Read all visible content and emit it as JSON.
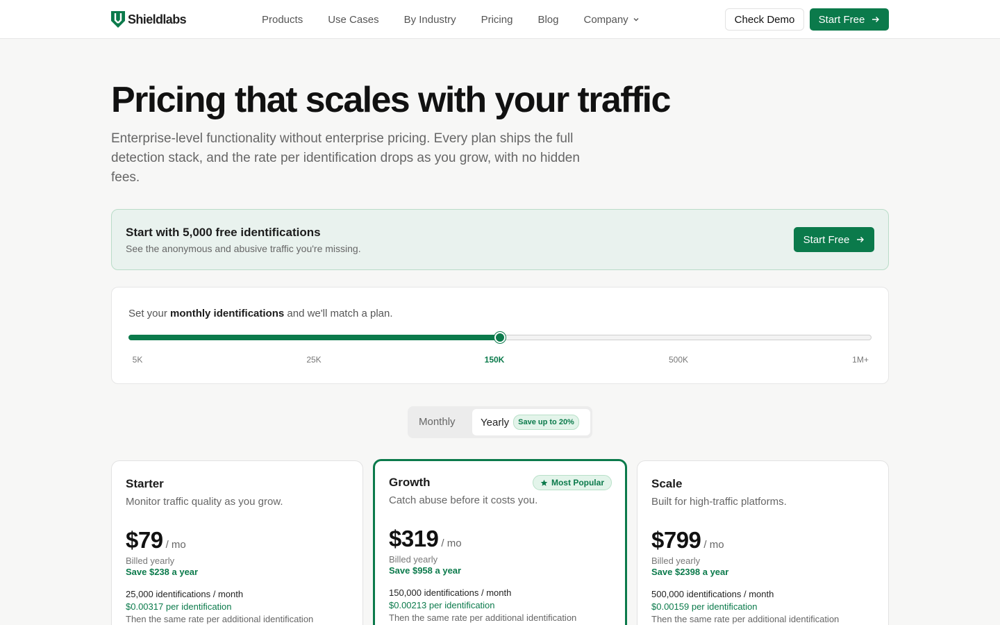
{
  "nav": {
    "brand": "Shieldlabs",
    "links": [
      "Products",
      "Use Cases",
      "By Industry",
      "Pricing",
      "Blog",
      "Company"
    ],
    "check_demo": "Check Demo",
    "start_free": "Start Free"
  },
  "hero": {
    "title": "Pricing that scales with your traffic",
    "subtitle": "Enterprise-level functionality without enterprise pricing. Every plan ships the full detection stack, and the rate per identification drops as you grow, with no hidden fees."
  },
  "banner": {
    "title": "Start with 5,000 free identifications",
    "subtitle": "See the anonymous and abusive traffic you're missing.",
    "button": "Start Free"
  },
  "slider": {
    "text_before": "Set your ",
    "text_bold": "monthly identifications",
    "text_after": " and we'll match a plan.",
    "ticks": [
      "5K",
      "25K",
      "150K",
      "500K",
      "1M+"
    ],
    "active_tick": "150K",
    "value_fraction": 0.5
  },
  "billing_toggle": {
    "monthly": "Monthly",
    "yearly": "Yearly",
    "yearly_badge": "Save up to 20%",
    "selected": "Yearly"
  },
  "plans": [
    {
      "name": "Starter",
      "description": "Monitor traffic quality as you grow.",
      "price": "$79",
      "per": "/ mo",
      "billed": "Billed yearly",
      "save": "Save $238 a year",
      "identifications": "25,000 identifications / month",
      "rate": "$0.00317 per identification",
      "then": "Then the same rate per additional identification"
    },
    {
      "name": "Growth",
      "description": "Catch abuse before it costs you.",
      "badge": "Most Popular",
      "price": "$319",
      "per": "/ mo",
      "billed": "Billed yearly",
      "save": "Save $958 a year",
      "identifications": "150,000 identifications / month",
      "rate": "$0.00213 per identification",
      "then": "Then the same rate per additional identification"
    },
    {
      "name": "Scale",
      "description": "Built for high-traffic platforms.",
      "price": "$799",
      "per": "/ mo",
      "billed": "Billed yearly",
      "save": "Save $2398 a year",
      "identifications": "500,000 identifications / month",
      "rate": "$0.00159 per identification",
      "then": "Then the same rate per additional identification"
    }
  ],
  "colors": {
    "accent": "#0b7a4b",
    "banner_bg": "#e9f2ee",
    "page_bg": "#f7f7f6"
  },
  "icons": [
    "shield-logo-icon",
    "chevron-down-icon",
    "arrow-right-icon",
    "star-icon"
  ]
}
